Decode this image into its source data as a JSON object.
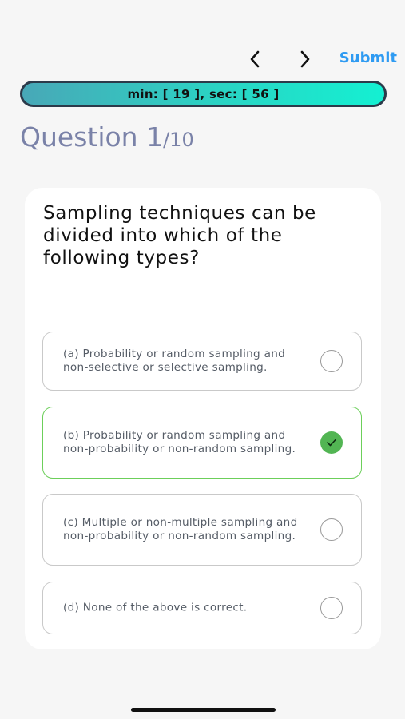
{
  "nav": {
    "prev_icon": "chevron-left-icon",
    "next_icon": "chevron-right-icon",
    "submit_label": "Submit",
    "submit_color": "#2f9bf2"
  },
  "timer": {
    "text": "min: [ 19 ], sec: [ 56 ]"
  },
  "question": {
    "label": "Question 1",
    "total": "/10",
    "prompt": "Sampling techniques can be divided into which of the following types?"
  },
  "options": [
    {
      "text": "(a) Probability or random sampling and non-selective or selective sampling.",
      "selected": false
    },
    {
      "text": "(b) Probability or random sampling and non-probability or non-random sampling.",
      "selected": true
    },
    {
      "text": "(c) Multiple or non-multiple sampling and non-probability or non-random sampling.",
      "selected": false
    },
    {
      "text": "(d) None of the above is correct.",
      "selected": false
    }
  ],
  "colors": {
    "accent": "#2f9bf2",
    "selected": "#52b553",
    "title": "#7a82a8"
  }
}
